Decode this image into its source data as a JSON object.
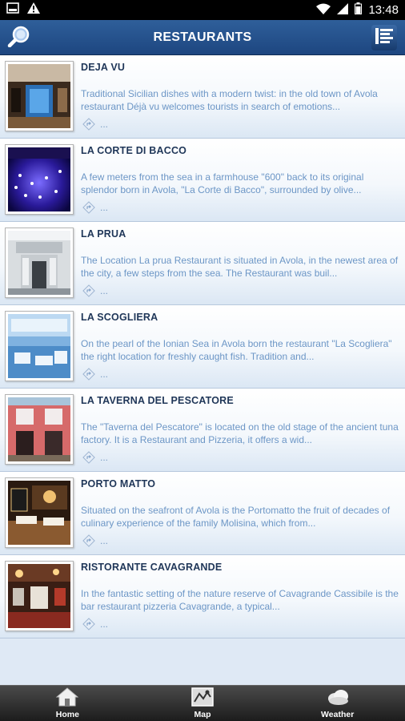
{
  "status_bar": {
    "time": "13:48",
    "icons": [
      "image-icon",
      "warning-icon",
      "wifi-icon",
      "signal-icon",
      "battery-icon"
    ]
  },
  "header": {
    "title": "RESTAURANTS",
    "left_icon": "search-icon",
    "right_icon": "list-menu-icon"
  },
  "restaurants": [
    {
      "name": "DEJA VU",
      "description": "Traditional Sicilian dishes with a modern twist: in the old town of Avola restaurant Déjà vu welcomes tourists in search of emotions...",
      "more": "..."
    },
    {
      "name": "LA CORTE DI BACCO",
      "description": "A few meters from the sea in a farmhouse \"600\" back to its original splendor born in Avola, \"La Corte di Bacco\", surrounded by olive...",
      "more": "..."
    },
    {
      "name": "LA PRUA",
      "description": "The Location  La prua Restaurant is situated in Avola, in the newest area of the city, a few steps from the sea. The Restaurant was buil...",
      "more": "..."
    },
    {
      "name": "LA SCOGLIERA",
      "description": "On the pearl of the Ionian Sea in Avola born the restaurant \"La Scogliera\" the right location for freshly caught fish. Tradition and...",
      "more": "..."
    },
    {
      "name": "LA TAVERNA DEL PESCATORE",
      "description": "The \"Taverna del Pescatore\" is located on the old stage of the ancient tuna factory. It is a Restaurant and Pizzeria, it offers a wid...",
      "more": "..."
    },
    {
      "name": "PORTO MATTO",
      "description": "Situated on the seafront of Avola is the Portomatto the fruit of decades of culinary experience of the family Molisina, which from...",
      "more": "..."
    },
    {
      "name": "RISTORANTE CAVAGRANDE",
      "description": "In the fantastic setting of the nature reserve of Cavagrande Cassibile is the bar restaurant pizzeria Cavagrande, a typical...",
      "more": "..."
    }
  ],
  "bottom_nav": {
    "home": "Home",
    "map": "Map",
    "weather": "Weather"
  },
  "colors": {
    "header": "#1d4680",
    "title_text": "#1f3658",
    "description_text": "#6c96c6",
    "background": "#dfe9f5"
  }
}
